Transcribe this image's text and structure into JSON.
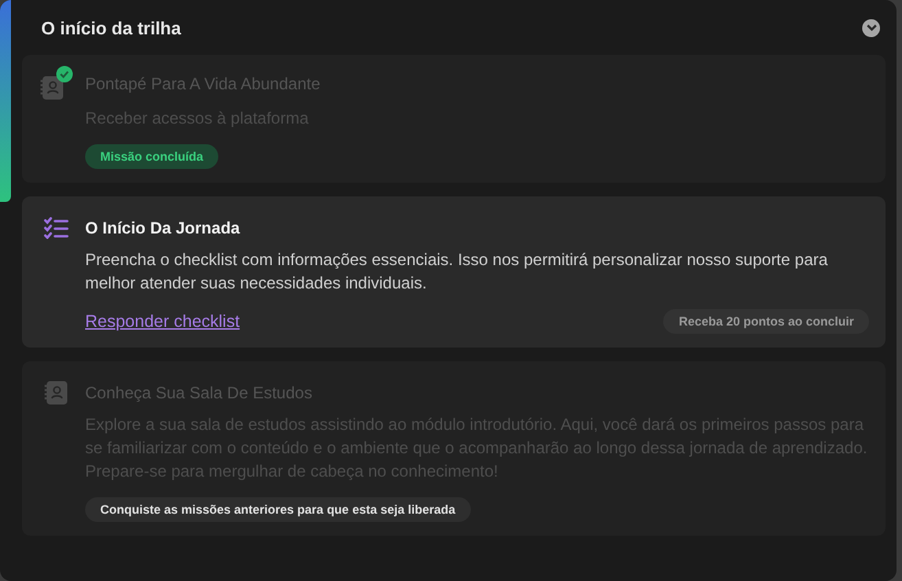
{
  "section": {
    "title": "O início da trilha",
    "expanded": true
  },
  "missions": [
    {
      "kind": "completed",
      "title": "Pontapé Para A Vida Abundante",
      "description": [
        "Receber acessos à plataforma"
      ],
      "badge": "Missão concluída"
    },
    {
      "kind": "active",
      "title": "O Início Da Jornada",
      "description": [
        "Preencha o checklist com informações essenciais. Isso nos permitirá personalizar nosso suporte para melhor atender suas necessidades individuais."
      ],
      "link": "Responder checklist",
      "badge": "Receba 20 pontos ao concluir"
    },
    {
      "kind": "locked",
      "title": "Conheça Sua Sala De Estudos",
      "description": [
        "Explore a sua sala de estudos assistindo ao módulo introdutório. Aqui, você dará os primeiros passos para se familiarizar com o conteúdo e o ambiente que o acompanharão ao longo dessa jornada de aprendizado.",
        "Prepare-se para mergulhar de cabeça no conhecimento!"
      ],
      "badge": "Conquiste as missões anteriores para que esta seja liberada"
    }
  ]
}
